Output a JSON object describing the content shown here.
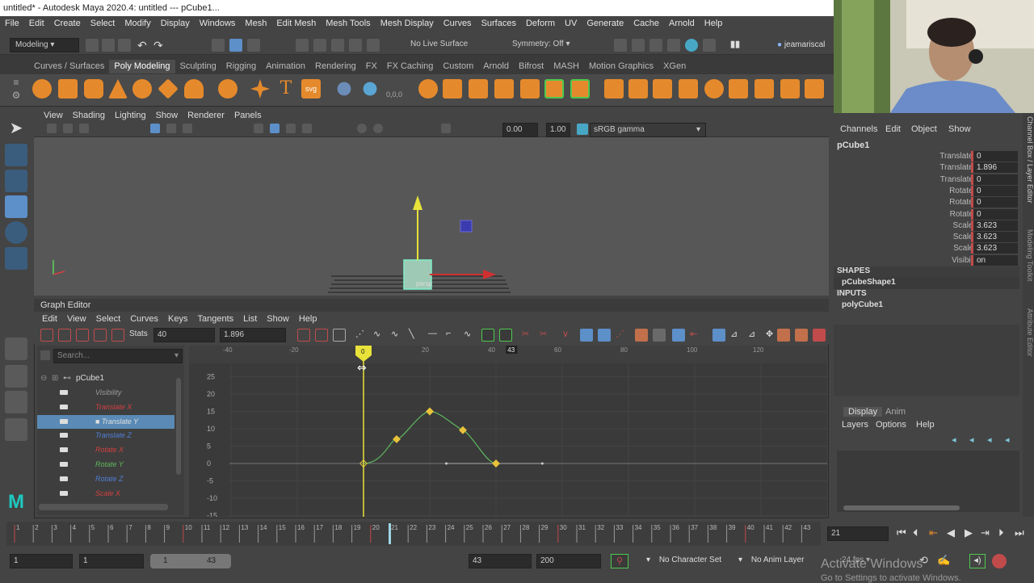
{
  "title": "untitled* - Autodesk Maya 2020.4: untitled   ---   pCube1...",
  "menubar": [
    "File",
    "Edit",
    "Create",
    "Select",
    "Modify",
    "Display",
    "Windows",
    "Mesh",
    "Edit Mesh",
    "Mesh Tools",
    "Mesh Display",
    "Curves",
    "Surfaces",
    "Deform",
    "UV",
    "Generate",
    "Cache",
    "Arnold",
    "Help"
  ],
  "status": {
    "menuset": "Modeling",
    "live_surface": "No Live Surface",
    "symmetry": "Symmetry: Off",
    "user": "jeamariscal"
  },
  "shelf_tabs": [
    "Curves / Surfaces",
    "Poly Modeling",
    "Sculpting",
    "Rigging",
    "Animation",
    "Rendering",
    "FX",
    "FX Caching",
    "Custom",
    "Arnold",
    "Bifrost",
    "MASH",
    "Motion Graphics",
    "XGen"
  ],
  "shelf_active": "Poly Modeling",
  "shelf_labels": {
    "text_tool": "T",
    "svg_tool": "svg",
    "coords": "0,0,0"
  },
  "viewport": {
    "menu": [
      "View",
      "Shading",
      "Lighting",
      "Show",
      "Renderer",
      "Panels"
    ],
    "field1": "0.00",
    "field2": "1.00",
    "colorspace": "sRGB gamma",
    "camera": "persp"
  },
  "graph_editor": {
    "title": "Graph Editor",
    "menu": [
      "Edit",
      "View",
      "Select",
      "Curves",
      "Keys",
      "Tangents",
      "List",
      "Show",
      "Help"
    ],
    "stats_label": "Stats",
    "stats_frame": "40",
    "stats_value": "1.896",
    "search_placeholder": "Search...",
    "object": "pCube1",
    "channels": [
      {
        "name": "Visibility",
        "color": "#9a9a9a",
        "selected": false
      },
      {
        "name": "Translate X",
        "color": "#d24040",
        "selected": false
      },
      {
        "name": "Translate Y",
        "color": "#e0e0e0",
        "selected": true
      },
      {
        "name": "Translate Z",
        "color": "#4f7fd6",
        "selected": false
      },
      {
        "name": "Rotate X",
        "color": "#d24040",
        "selected": false
      },
      {
        "name": "Rotate Y",
        "color": "#5fb85f",
        "selected": false
      },
      {
        "name": "Rotate Z",
        "color": "#4f7fd6",
        "selected": false
      },
      {
        "name": "Scale X",
        "color": "#d24040",
        "selected": false
      }
    ],
    "x_ticks": [
      "-40",
      "-20",
      "20",
      "40",
      "60",
      "80",
      "100",
      "120"
    ],
    "y_ticks": [
      "25",
      "20",
      "15",
      "10",
      "5",
      "0",
      "-5",
      "-10",
      "-15"
    ],
    "current_frame": "0",
    "end_marker": "43"
  },
  "channel_box": {
    "menu": [
      "Channels",
      "Edit",
      "Object",
      "Show"
    ],
    "object": "pCube1",
    "attrs": [
      {
        "label": "Translate X",
        "value": "0"
      },
      {
        "label": "Translate Y",
        "value": "1.896"
      },
      {
        "label": "Translate Z",
        "value": "0"
      },
      {
        "label": "Rotate X",
        "value": "0"
      },
      {
        "label": "Rotate Y",
        "value": "0"
      },
      {
        "label": "Rotate Z",
        "value": "0"
      },
      {
        "label": "Scale X",
        "value": "3.623"
      },
      {
        "label": "Scale Y",
        "value": "3.623"
      },
      {
        "label": "Scale Z",
        "value": "3.623"
      },
      {
        "label": "Visibility",
        "value": "on"
      }
    ],
    "shapes_header": "SHAPES",
    "shape": "pCubeShape1",
    "inputs_header": "INPUTS",
    "input": "polyCube1",
    "side_tabs": [
      "Channel Box / Layer Editor",
      "Modeling Toolkit",
      "Attribute Editor"
    ]
  },
  "layers": {
    "tabs": [
      "Display",
      "Anim"
    ],
    "menu": [
      "Layers",
      "Options",
      "Help"
    ]
  },
  "timeline": {
    "ticks": [
      "1",
      "2",
      "3",
      "4",
      "5",
      "6",
      "7",
      "8",
      "9",
      "10",
      "11",
      "12",
      "13",
      "14",
      "15",
      "16",
      "17",
      "18",
      "19",
      "20",
      "21",
      "22",
      "23",
      "24",
      "25",
      "26",
      "27",
      "28",
      "29",
      "30",
      "31",
      "32",
      "33",
      "34",
      "35",
      "36",
      "37",
      "38",
      "39",
      "40",
      "41",
      "42",
      "43"
    ],
    "current_frame": "21"
  },
  "range": {
    "start": "1",
    "playback_start": "1",
    "slider_start": "1",
    "slider_end": "43",
    "playback_end": "43",
    "end": "200",
    "character_set": "No Character Set",
    "anim_layer": "No Anim Layer",
    "fps": "24 fps"
  },
  "watermark": {
    "line1": "Activate Windows",
    "line2": "Go to Settings to activate Windows."
  }
}
